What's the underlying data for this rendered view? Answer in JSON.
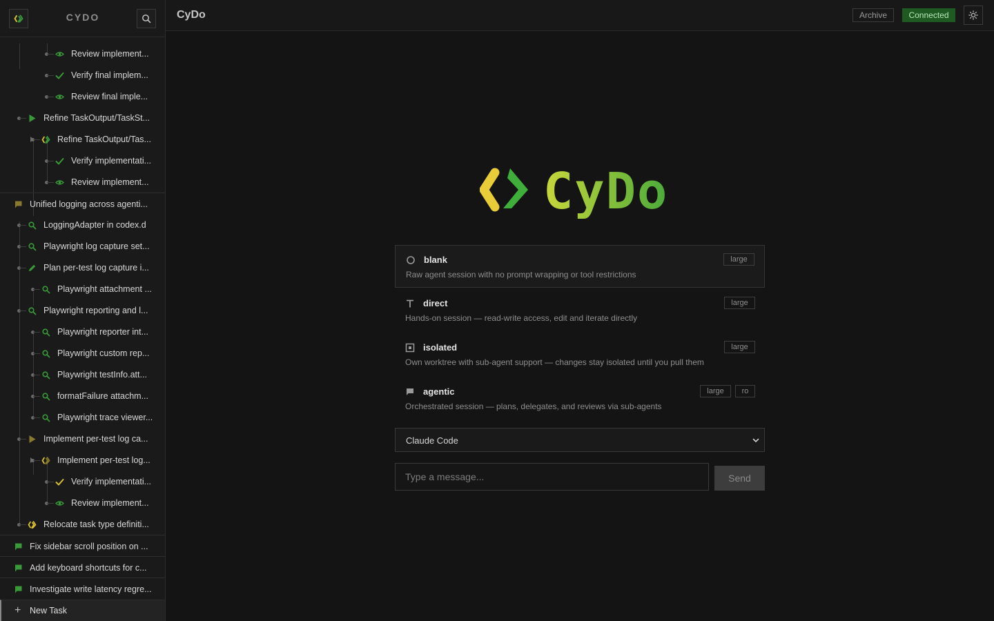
{
  "sidebar": {
    "title": "CYDO",
    "tree": [
      {
        "label": "Review implement...",
        "icon": "eye-icon",
        "color": "#3a9a3a"
      },
      {
        "label": "Verify final implem...",
        "icon": "check-icon",
        "color": "#3a9a3a"
      },
      {
        "label": "Review final imple...",
        "icon": "eye-icon",
        "color": "#3a9a3a"
      },
      {
        "label": "Refine TaskOutput/TaskSt...",
        "icon": "play-icon",
        "color": "#3a9a3a"
      },
      {
        "label": "Refine TaskOutput/Tas...",
        "icon": "cydo-icon",
        "color": "#3a9a3a"
      },
      {
        "label": "Verify implementati...",
        "icon": "check-icon",
        "color": "#3a9a3a"
      },
      {
        "label": "Review implement...",
        "icon": "eye-icon",
        "color": "#3a9a3a"
      },
      {
        "label": "Unified logging across agenti...",
        "icon": "flag-icon",
        "color": "#8a7a30"
      },
      {
        "label": "LoggingAdapter in codex.d",
        "icon": "search-icon",
        "color": "#3a9a3a"
      },
      {
        "label": "Playwright log capture set...",
        "icon": "search-icon",
        "color": "#3a9a3a"
      },
      {
        "label": "Plan per-test log capture i...",
        "icon": "pencil-icon",
        "color": "#3a9a3a"
      },
      {
        "label": "Playwright attachment ...",
        "icon": "search-icon",
        "color": "#3a9a3a"
      },
      {
        "label": "Playwright reporting and l...",
        "icon": "search-icon",
        "color": "#3a9a3a"
      },
      {
        "label": "Playwright reporter int...",
        "icon": "search-icon",
        "color": "#3a9a3a"
      },
      {
        "label": "Playwright custom rep...",
        "icon": "search-icon",
        "color": "#3a9a3a"
      },
      {
        "label": "Playwright testInfo.att...",
        "icon": "search-icon",
        "color": "#3a9a3a"
      },
      {
        "label": "formatFailure attachm...",
        "icon": "search-icon",
        "color": "#3a9a3a"
      },
      {
        "label": "Playwright trace viewer...",
        "icon": "search-icon",
        "color": "#3a9a3a"
      },
      {
        "label": "Implement per-test log ca...",
        "icon": "play-icon",
        "color": "#8a7a30"
      },
      {
        "label": "Implement per-test log...",
        "icon": "cydo-icon",
        "color": "#8a7a30"
      },
      {
        "label": "Verify implementati...",
        "icon": "check-icon",
        "color": "#d8c030"
      },
      {
        "label": "Review implement...",
        "icon": "eye-icon",
        "color": "#3a9a3a"
      },
      {
        "label": "Relocate task type definiti...",
        "icon": "cydo-icon",
        "color": "#d8c030"
      },
      {
        "label": "Fix sidebar scroll position on ...",
        "icon": "flag-icon",
        "color": "#3a9a3a"
      },
      {
        "label": "Add keyboard shortcuts for c...",
        "icon": "flag-icon",
        "color": "#3a9a3a"
      },
      {
        "label": "Investigate write latency regre...",
        "icon": "flag-icon",
        "color": "#3a9a3a"
      }
    ],
    "new_task_label": "New Task"
  },
  "topbar": {
    "title": "CyDo",
    "archive_label": "Archive",
    "status_label": "Connected"
  },
  "logo_text": "CyDo",
  "modes": [
    {
      "name": "blank",
      "icon": "circle-icon",
      "desc": "Raw agent session with no prompt wrapping or tool restrictions",
      "tags": [
        "large"
      ]
    },
    {
      "name": "direct",
      "icon": "tee-icon",
      "desc": "Hands-on session — read-write access, edit and iterate directly",
      "tags": [
        "large"
      ]
    },
    {
      "name": "isolated",
      "icon": "box-icon",
      "desc": "Own worktree with sub-agent support — changes stay isolated until you pull them",
      "tags": [
        "large"
      ]
    },
    {
      "name": "agentic",
      "icon": "flag-icon",
      "desc": "Orchestrated session — plans, delegates, and reviews via sub-agents",
      "tags": [
        "large",
        "ro"
      ]
    }
  ],
  "agent_select": {
    "value": "Claude Code"
  },
  "composer": {
    "placeholder": "Type a message...",
    "send_label": "Send"
  },
  "colors": {
    "green": "#3a9a3a",
    "yellow": "#d8c030",
    "olive": "#8a7a30",
    "connected_bg": "#1f5a23"
  }
}
